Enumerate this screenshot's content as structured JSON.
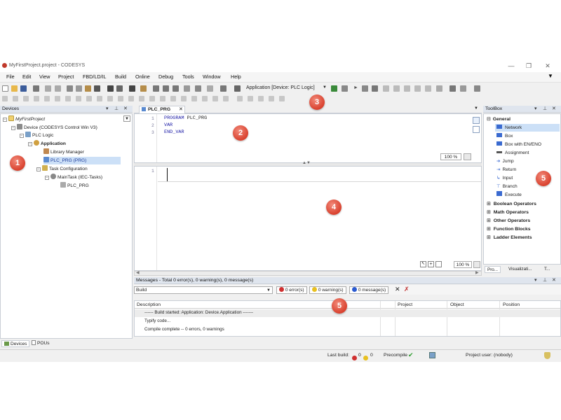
{
  "window": {
    "title": "MyFirstProject.project - CODESYS",
    "controls": [
      "—",
      "❐",
      "✕"
    ]
  },
  "menu": [
    "File",
    "Edit",
    "View",
    "Project",
    "FBD/LD/IL",
    "Build",
    "Online",
    "Debug",
    "Tools",
    "Window",
    "Help"
  ],
  "toolbar": {
    "active_application": "Application [Device: PLC Logic]"
  },
  "devices_panel": {
    "title": "Devices",
    "tree": [
      {
        "label": "MyFirstProject",
        "italic": true
      },
      {
        "label": "Device (CODESYS Control Win V3)"
      },
      {
        "label": "PLC Logic"
      },
      {
        "label": "Application",
        "bold": true
      },
      {
        "label": "Library Manager"
      },
      {
        "label": "PLC_PRG (PRG)",
        "selected": true
      },
      {
        "label": "Task Configuration"
      },
      {
        "label": "MainTask (IEC-Tasks)"
      },
      {
        "label": "PLC_PRG"
      }
    ],
    "tabs": [
      "Devices",
      "POUs"
    ]
  },
  "editor": {
    "tab_label": "PLC_PRG",
    "decl_lines": [
      {
        "num": "1",
        "kw": "PROGRAM",
        "rest": " PLC_PRG"
      },
      {
        "num": "2",
        "kw": "VAR",
        "rest": ""
      },
      {
        "num": "3",
        "kw": "END_VAR",
        "rest": ""
      }
    ],
    "body_line_num": "1",
    "zoom_top": "100 %",
    "zoom_bottom": "100 %"
  },
  "toolbox": {
    "title": "ToolBox",
    "general_label": "General",
    "items": [
      "Network",
      "Box",
      "Box with EN/ENO",
      "Assignment",
      "Jump",
      "Return",
      "Input",
      "Branch",
      "Execute"
    ],
    "categories": [
      "Boolean Operators",
      "Math Operators",
      "Other Operators",
      "Function Blocks",
      "Ladder Elements"
    ],
    "tabs": [
      "Pro...",
      "Visualizati...",
      "T..."
    ]
  },
  "messages": {
    "title": "Messages - Total 0 error(s), 0 warning(s), 0 message(s)",
    "source": "Build",
    "errors": "0 error(s)",
    "warnings": "0 warning(s)",
    "msgs": "0 message(s)",
    "columns": [
      "Description",
      "Project",
      "Object",
      "Position"
    ],
    "rows": [
      "------ Build started: Application: Device.Application -------",
      "Typify code...",
      "Compile complete -- 0 errors, 0 warnings"
    ]
  },
  "status": {
    "last_build_label": "Last build:",
    "errors": "0",
    "warnings": "0",
    "precompile": "Precompile",
    "user": "Project user: (nobody)"
  },
  "badges": [
    "1",
    "2",
    "3",
    "4",
    "5",
    "5"
  ],
  "colors": {
    "badge": "#d9412e",
    "header": "#dfe5ee",
    "selection": "#cce0f7"
  }
}
